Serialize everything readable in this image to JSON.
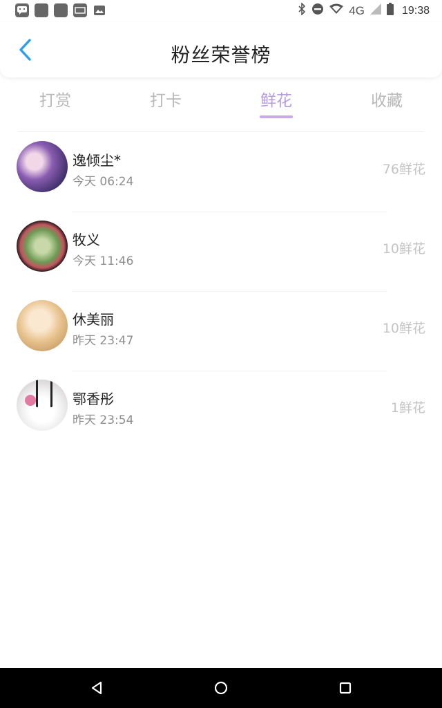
{
  "status_bar": {
    "time": "19:38",
    "network": "4G",
    "left_icons": [
      "message-icon",
      "app-icon",
      "app-icon",
      "app-icon",
      "image-icon"
    ],
    "right_icons": [
      "bluetooth-icon",
      "dnd-icon",
      "wifi-icon",
      "signal-icon",
      "battery-icon"
    ]
  },
  "header": {
    "title": "粉丝荣誉榜",
    "back_icon": "chevron-left-icon",
    "accent": "#2a9df4"
  },
  "tabs": [
    {
      "label": "打赏",
      "active": false
    },
    {
      "label": "打卡",
      "active": false
    },
    {
      "label": "鲜花",
      "active": true
    },
    {
      "label": "收藏",
      "active": false
    }
  ],
  "tab_active_color": "#b59be0",
  "list": [
    {
      "name": "逸倾尘*",
      "time": "今天 06:24",
      "count": "76鲜花"
    },
    {
      "name": "牧义",
      "time": "今天 11:46",
      "count": "10鲜花"
    },
    {
      "name": "休美丽",
      "time": "昨天 23:47",
      "count": "10鲜花"
    },
    {
      "name": "鄂香彤",
      "time": "昨天 23:54",
      "count": "1鲜花"
    }
  ],
  "nav_bar": {
    "buttons": [
      "back-triangle-icon",
      "home-circle-icon",
      "recents-square-icon"
    ]
  }
}
